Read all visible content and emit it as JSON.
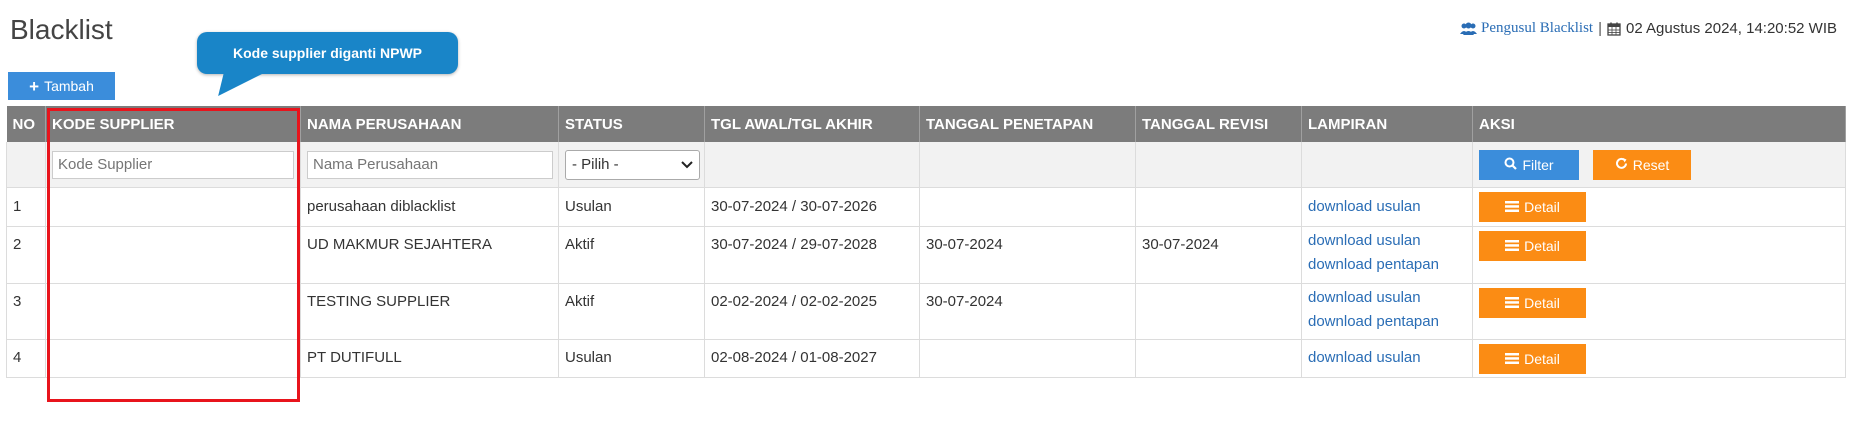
{
  "page": {
    "title": "Blacklist"
  },
  "topbar": {
    "pengusul_link": "Pengusul Blacklist",
    "separator": "|",
    "datetime": "02 Agustus 2024, 14:20:52 WIB"
  },
  "toolbar": {
    "tambah_label": "Tambah"
  },
  "callout": {
    "text": "Kode supplier diganti NPWP"
  },
  "table": {
    "headers": {
      "no": "NO",
      "kode_supplier": "KODE SUPPLIER",
      "nama_perusahaan": "NAMA PERUSAHAAN",
      "status": "STATUS",
      "tgl": "TGL AWAL/TGL AKHIR",
      "tanggal_penetapan": "TANGGAL PENETAPAN",
      "tanggal_revisi": "TANGGAL REVISI",
      "lampiran": "LAMPIRAN",
      "aksi": "AKSI"
    },
    "filters": {
      "kode_supplier_placeholder": "Kode Supplier",
      "nama_perusahaan_placeholder": "Nama Perusahaan",
      "status_selected": "- Pilih -",
      "filter_label": "Filter",
      "reset_label": "Reset"
    },
    "detail_label": "Detail",
    "rows": [
      {
        "no": "1",
        "kode": "",
        "nama": "perusahaan diblacklist",
        "status": "Usulan",
        "tgl": "30-07-2024 / 30-07-2026",
        "penetapan": "",
        "revisi": "",
        "lampiran": [
          "download usulan"
        ]
      },
      {
        "no": "2",
        "kode": "",
        "nama": "UD MAKMUR SEJAHTERA",
        "status": "Aktif",
        "tgl": "30-07-2024 / 29-07-2028",
        "penetapan": "30-07-2024",
        "revisi": "30-07-2024",
        "lampiran": [
          "download usulan",
          "download pentapan"
        ]
      },
      {
        "no": "3",
        "kode": "",
        "nama": "TESTING SUPPLIER",
        "status": "Aktif",
        "tgl": "02-02-2024 / 02-02-2025",
        "penetapan": "30-07-2024",
        "revisi": "",
        "lampiran": [
          "download usulan",
          "download pentapan"
        ]
      },
      {
        "no": "4",
        "kode": "",
        "nama": "PT DUTIFULL",
        "status": "Usulan",
        "tgl": "02-08-2024 / 01-08-2027",
        "penetapan": "",
        "revisi": "",
        "lampiran": [
          "download usulan"
        ]
      }
    ]
  },
  "colors": {
    "header_bg": "#7c7c7c",
    "primary": "#3b8ddb",
    "warning": "#fb8c14",
    "callout": "#1985c8",
    "highlight": "#e8141c"
  },
  "icons": {
    "users": "users-icon",
    "calendar": "calendar-icon",
    "plus": "plus-icon",
    "search": "search-icon",
    "refresh": "refresh-icon",
    "list": "list-icon",
    "chevron": "chevron-down-icon"
  }
}
